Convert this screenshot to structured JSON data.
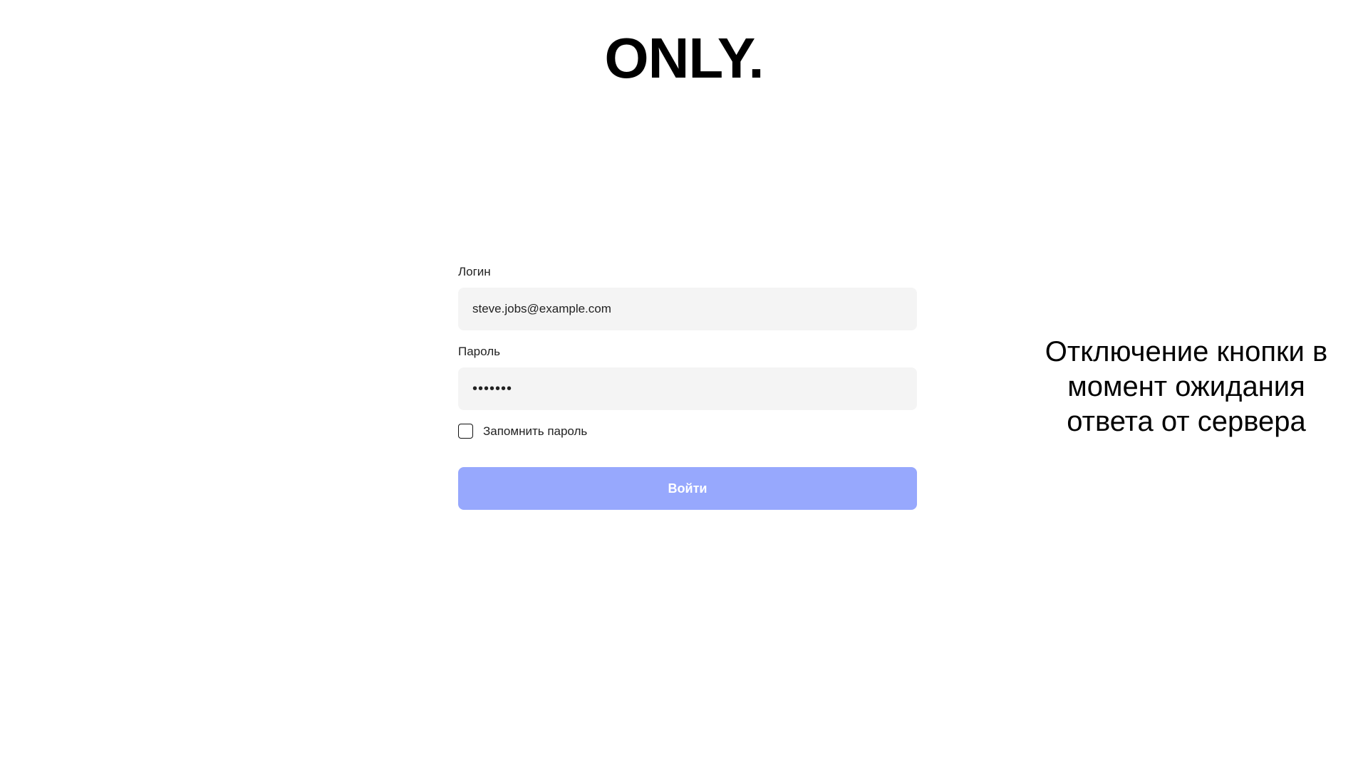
{
  "logo": {
    "text": "ONLY."
  },
  "login_form": {
    "login_label": "Логин",
    "login_value": "steve.jobs@example.com",
    "password_label": "Пароль",
    "password_value": "•••••••",
    "remember_label": "Запомнить пароль",
    "remember_checked": false,
    "submit_label": "Войти",
    "submit_disabled": true
  },
  "annotation": {
    "lines": [
      "Отключение кнопки в",
      "момент ожидания",
      "ответа от сервера"
    ]
  },
  "colors": {
    "background": "#ffffff",
    "input_background": "#f4f4f4",
    "button_disabled": "#97a8fd",
    "text": "#111111"
  }
}
